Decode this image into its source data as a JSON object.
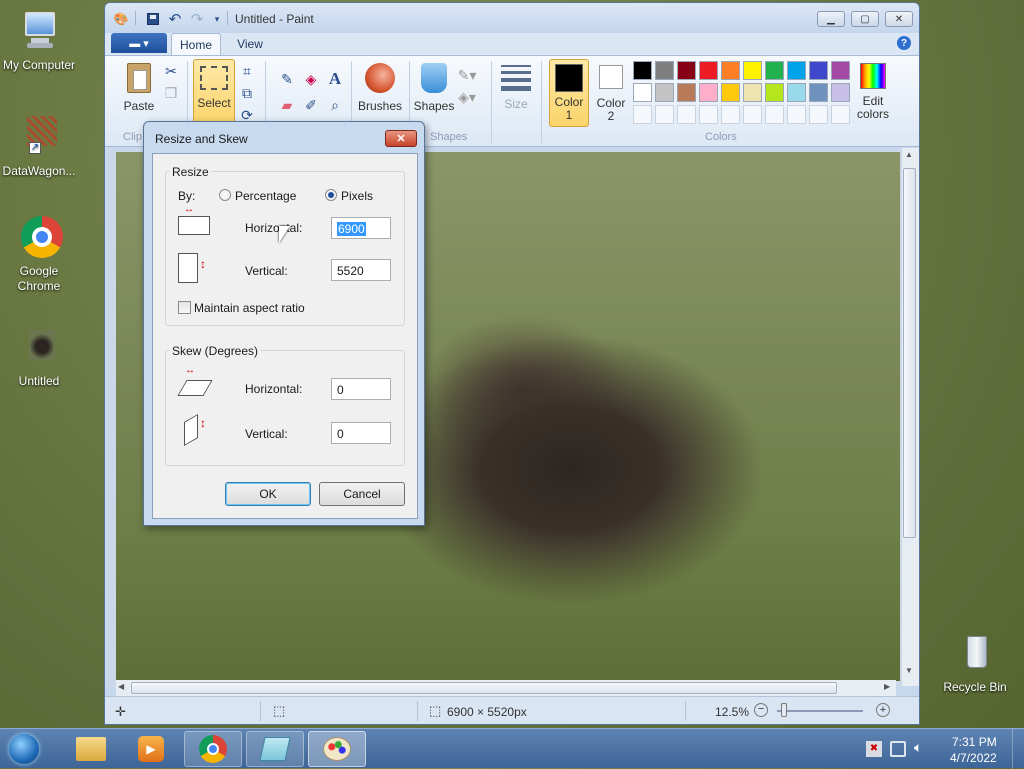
{
  "desktop": {
    "icons": [
      {
        "label": "My Computer",
        "icon": "computer-icon"
      },
      {
        "label": "DataWagon...",
        "icon": "shortcut-icon"
      },
      {
        "label": "Google\nChrome",
        "icon": "chrome-icon"
      },
      {
        "label": "Untitled",
        "icon": "image-file-icon"
      },
      {
        "label": "Recycle Bin",
        "icon": "recycle-bin-icon"
      }
    ]
  },
  "window": {
    "title": "Untitled - Paint",
    "tabs": {
      "file": "",
      "home": "Home",
      "view": "View"
    },
    "ribbon": {
      "paste": "Paste",
      "clipboard_group": "Clip",
      "select": "Select",
      "brushes": "Brushes",
      "shapes": "Shapes",
      "shapes_group": "Shapes",
      "size": "Size",
      "color1": "Color\n1",
      "color2": "Color\n2",
      "colors_group": "Colors",
      "edit_colors": "Edit\ncolors"
    },
    "palette": [
      "#000000",
      "#7f7f7f",
      "#880015",
      "#ed1c24",
      "#ff7f27",
      "#fff200",
      "#22b14c",
      "#00a2e8",
      "#3f48cc",
      "#a349a4",
      "#ffffff",
      "#c3c3c3",
      "#b97a57",
      "#ffaec9",
      "#ffc90e",
      "#efe4b0",
      "#b5e61d",
      "#99d9ea",
      "#7092be",
      "#c8bfe7"
    ],
    "status": {
      "dimensions": "6900 × 5520px",
      "zoom": "12.5%"
    }
  },
  "dialog": {
    "title": "Resize and Skew",
    "resize_group": "Resize",
    "by_label": "By:",
    "percentage_label": "Percentage",
    "pixels_label": "Pixels",
    "horizontal_label": "Horizontal:",
    "vertical_label": "Vertical:",
    "horizontal_value": "6900",
    "vertical_value": "5520",
    "maintain_aspect": "Maintain aspect ratio",
    "skew_group": "Skew (Degrees)",
    "skew_horizontal_label": "Horizontal:",
    "skew_vertical_label": "Vertical:",
    "skew_horizontal_value": "0",
    "skew_vertical_value": "0",
    "ok": "OK",
    "cancel": "Cancel"
  },
  "taskbar": {
    "time": "7:31 PM",
    "date": "4/7/2022"
  }
}
